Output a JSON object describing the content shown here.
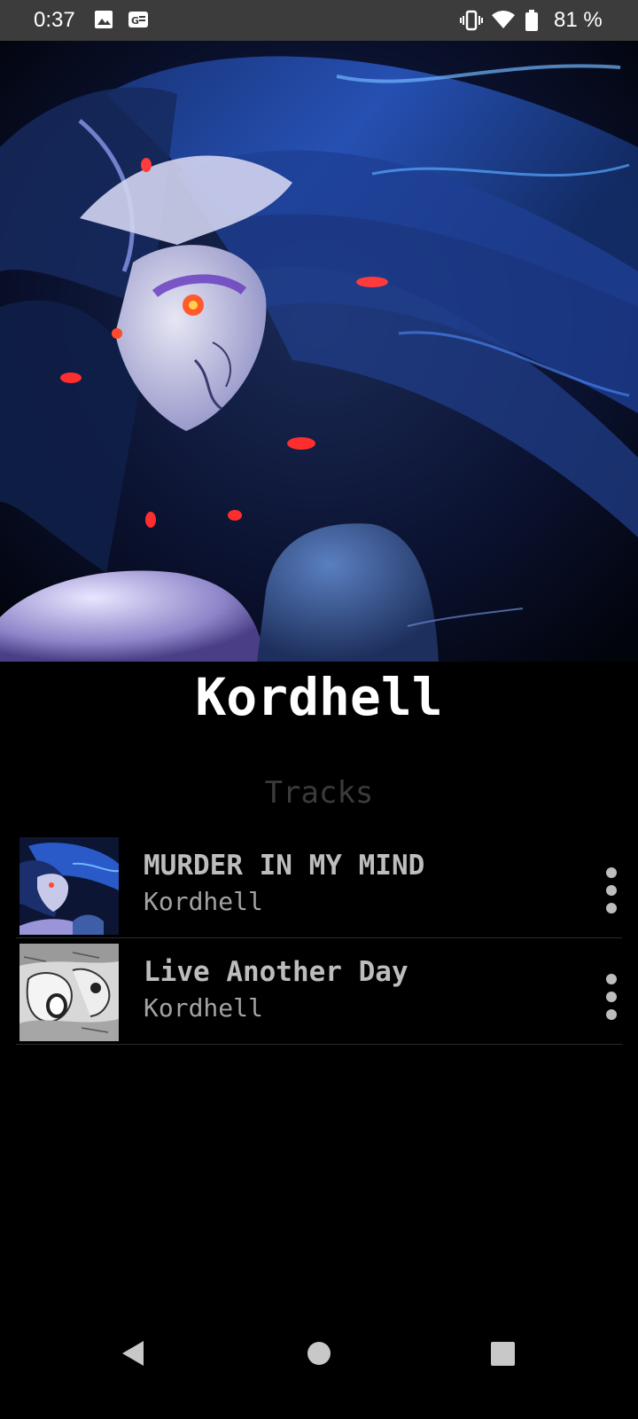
{
  "status_bar": {
    "time": "0:37",
    "battery_percent": "81 %",
    "icons": [
      "image-icon",
      "news-icon",
      "vibrate-icon",
      "wifi-icon",
      "battery-icon"
    ]
  },
  "artist": {
    "name": "Kordhell"
  },
  "tracks_section": {
    "title": "Tracks",
    "items": [
      {
        "title": "MURDER IN MY MIND",
        "artist": "Kordhell",
        "thumbnail": "dark-blue-creature-art"
      },
      {
        "title": "Live Another Day",
        "artist": "Kordhell",
        "thumbnail": "black-white-sketch-art"
      }
    ]
  },
  "nav_bar": {
    "buttons": [
      "back-icon",
      "home-icon",
      "recents-icon"
    ]
  },
  "colors": {
    "background": "#000000",
    "status_bar": "#3c3c3c",
    "title_text": "#ffffff",
    "section_title": "#3b3b3b",
    "track_title": "#bdbdbd",
    "track_artist": "#a3a3a3"
  }
}
